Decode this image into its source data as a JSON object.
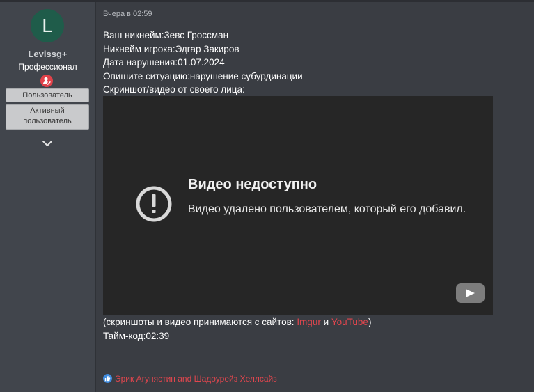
{
  "author": {
    "avatar_letter": "L",
    "username": "Levissg+",
    "title": "Профессионал",
    "badges": [
      "Пользователь",
      "Активный пользователь"
    ],
    "expand_icon": "chevron-down-icon",
    "avatar_color": "#1f5c4a"
  },
  "post": {
    "date": "Вчера в 02:59",
    "lines": [
      "Ваш никнейм:Зевс Гроссман",
      "Никнейм игрока:Эдгар Закиров",
      "Дата нарушения:01.07.2024",
      "Опишите ситуацию:нарушение субурдинации",
      "Скриншот/видео от своего лица:"
    ],
    "video": {
      "error_title": "Видео недоступно",
      "error_message": "Видео удалено пользователем, который его добавил.",
      "icon": "alert-circle-icon",
      "logo": "youtube-logo-icon"
    },
    "sources_prefix": "(скриншоты и видео принимаются с сайтов: ",
    "sources_link1": "Imgur",
    "sources_and": " и ",
    "sources_link2": "YouTube",
    "sources_suffix": ")",
    "timecode": "Тайм-код:02:39"
  },
  "reactions": {
    "icon": "thumbs-up-icon",
    "text": "Эрик Агунястин and Шадоурейз Хеллсайз"
  },
  "colors": {
    "link": "#e1464e",
    "background": "#3a3d43",
    "sidebar": "#41454c",
    "video_bg": "#262626"
  }
}
